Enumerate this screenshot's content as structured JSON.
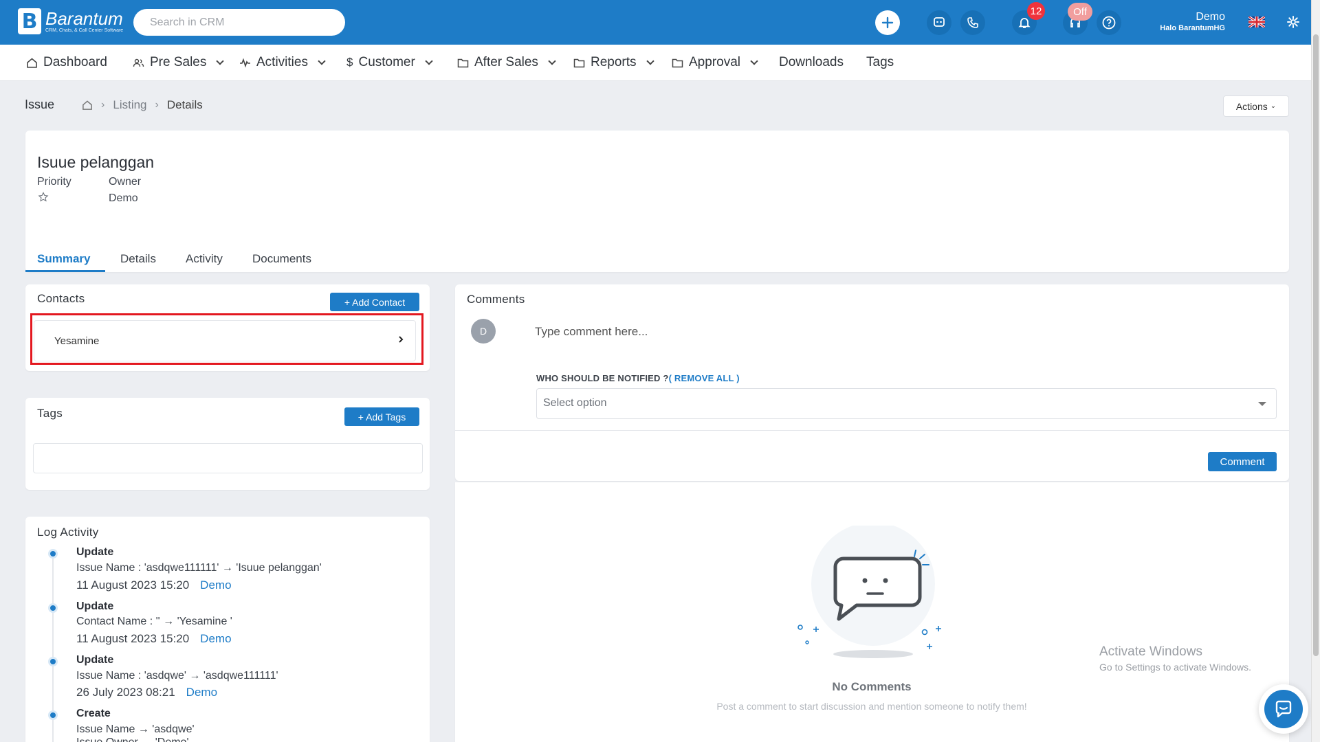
{
  "colors": {
    "brand": "#1e7cc7",
    "badge": "#f0323c",
    "highlight": "#e3171f"
  },
  "brand": {
    "name": "Barantum",
    "tagline": "CRM, Chats, & Call Center Software"
  },
  "search": {
    "placeholder": "Search in CRM"
  },
  "topbar": {
    "notifications_count": "12",
    "status_badge": "Off",
    "user_name": "Demo",
    "user_sub": "Halo BarantumHG",
    "icons": [
      "plus-icon",
      "chat-icon",
      "phone-icon",
      "bell-icon",
      "headset-icon",
      "help-icon",
      "flag-uk-icon",
      "gear-icon"
    ]
  },
  "nav": {
    "dashboard": "Dashboard",
    "pre_sales": "Pre Sales",
    "activities": "Activities",
    "customer": "Customer",
    "after_sales": "After Sales",
    "reports": "Reports",
    "approval": "Approval",
    "downloads": "Downloads",
    "tags": "Tags"
  },
  "breadcrumb": {
    "module": "Issue",
    "listing": "Listing",
    "current": "Details",
    "actions": "Actions"
  },
  "issue": {
    "title": "Isuue pelanggan",
    "priority_label": "Priority",
    "owner_label": "Owner",
    "owner_value": "Demo"
  },
  "tabs": {
    "summary": "Summary",
    "details": "Details",
    "activity": "Activity",
    "documents": "Documents"
  },
  "contacts": {
    "title": "Contacts",
    "add_button": "+ Add Contact",
    "items": [
      {
        "name": "Yesamine"
      }
    ]
  },
  "tags_card": {
    "title": "Tags",
    "add_button": "+ Add Tags"
  },
  "log": {
    "title": "Log Activity",
    "entries": [
      {
        "type": "Update",
        "text": "Issue Name : 'asdqwe111111' → 'Isuue pelanggan'",
        "date": "11 August 2023 15:20",
        "user": "Demo"
      },
      {
        "type": "Update",
        "text": "Contact Name : '' → 'Yesamine '",
        "date": "11 August 2023 15:20",
        "user": "Demo"
      },
      {
        "type": "Update",
        "text": "Issue Name : 'asdqwe' → 'asdqwe111111'",
        "date": "26 July 2023 08:21",
        "user": "Demo"
      },
      {
        "type": "Create",
        "text": "Issue Name → 'asdqwe'",
        "text2": "Issue Owner → 'Demo'"
      }
    ]
  },
  "comments": {
    "title": "Comments",
    "avatar_initial": "D",
    "input_placeholder": "Type comment here...",
    "notify_label": "WHO SHOULD BE NOTIFIED ?",
    "remove_all": "( REMOVE ALL )",
    "select_placeholder": "Select option",
    "comment_button": "Comment",
    "empty_title": "No Comments",
    "empty_subtitle": "Post a comment to start discussion and mention someone to notify them!"
  },
  "watermark": {
    "line1": "Activate Windows",
    "line2": "Go to Settings to activate Windows."
  }
}
